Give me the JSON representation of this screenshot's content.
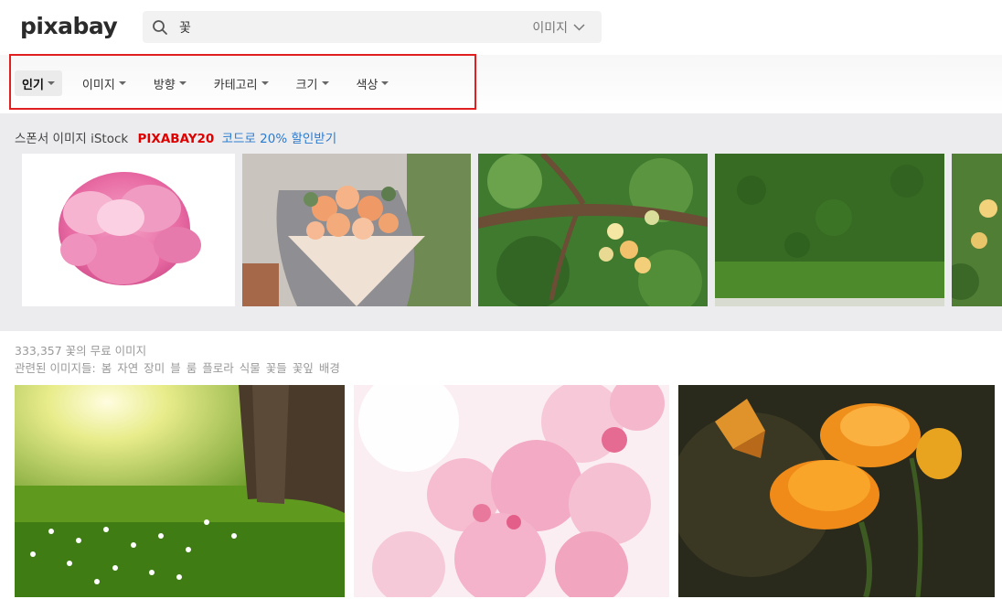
{
  "header": {
    "logo_text": "pixabay",
    "search_value": "꽃",
    "search_type": "이미지"
  },
  "filters": [
    {
      "label": "인기",
      "active": true
    },
    {
      "label": "이미지",
      "active": false
    },
    {
      "label": "방향",
      "active": false
    },
    {
      "label": "카테고리",
      "active": false
    },
    {
      "label": "크기",
      "active": false
    },
    {
      "label": "색상",
      "active": false
    }
  ],
  "sponsor": {
    "label": "스폰서 이미지 iStock",
    "promo_code": "PIXABAY20",
    "promo_text": "코드로 20% 할인받기"
  },
  "results": {
    "count_text": "333,357 꽃의 무료 이미지",
    "related_label": "관련된 이미지들:",
    "related_tags": [
      "봄",
      "자연",
      "장미",
      "블",
      "룸",
      "플로라",
      "식물",
      "꽃들",
      "꽃잎",
      "배경"
    ]
  },
  "colors": {
    "highlight_frame": "#e02020",
    "promo_code": "#e00000",
    "promo_link": "#2a7bd0"
  }
}
